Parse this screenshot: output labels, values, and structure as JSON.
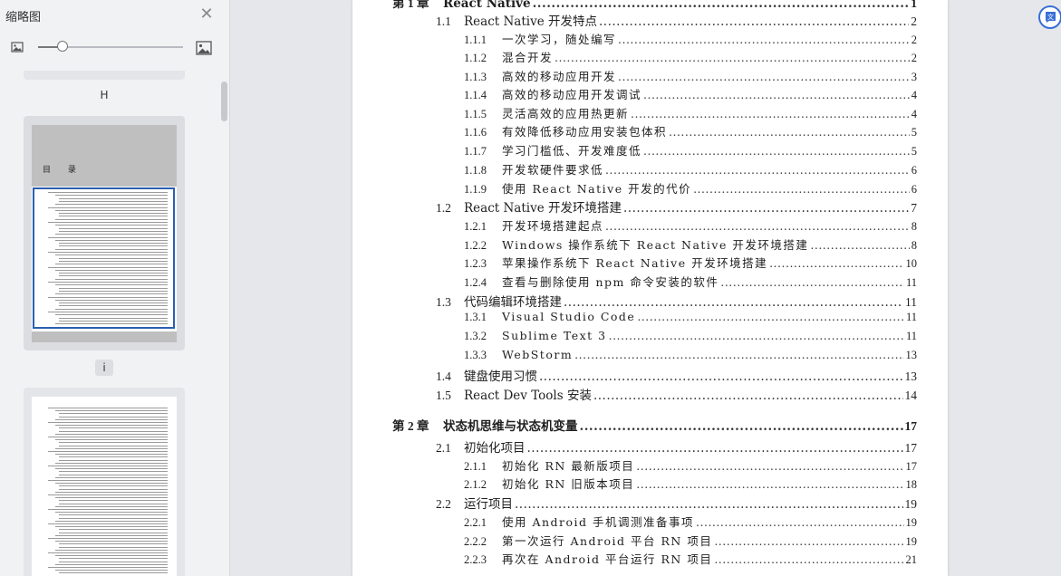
{
  "sidebar": {
    "title": "缩略图",
    "zoom_level": 0.17,
    "thumbnails": [
      {
        "label": "H",
        "heading": "目 录",
        "selected": true
      },
      {
        "label": "i",
        "selected": false
      }
    ]
  },
  "toc": [
    {
      "level": 0,
      "num": "第 1 章",
      "title": "React Native",
      "page": "1"
    },
    {
      "level": 1,
      "num": "1.1",
      "title": "React Native 开发特点",
      "page": "2"
    },
    {
      "level": 2,
      "num": "1.1.1",
      "title": "一次学习，随处编写",
      "page": "2"
    },
    {
      "level": 2,
      "num": "1.1.2",
      "title": "混合开发",
      "page": "2"
    },
    {
      "level": 2,
      "num": "1.1.3",
      "title": "高效的移动应用开发",
      "page": "3"
    },
    {
      "level": 2,
      "num": "1.1.4",
      "title": "高效的移动应用开发调试",
      "page": "4"
    },
    {
      "level": 2,
      "num": "1.1.5",
      "title": "灵活高效的应用热更新",
      "page": "4"
    },
    {
      "level": 2,
      "num": "1.1.6",
      "title": "有效降低移动应用安装包体积",
      "page": "5"
    },
    {
      "level": 2,
      "num": "1.1.7",
      "title": "学习门槛低、开发难度低",
      "page": "5"
    },
    {
      "level": 2,
      "num": "1.1.8",
      "title": "开发软硬件要求低",
      "page": "6"
    },
    {
      "level": 2,
      "num": "1.1.9",
      "title": "使用 React Native 开发的代价",
      "page": "6"
    },
    {
      "level": 1,
      "num": "1.2",
      "title": "React Native 开发环境搭建",
      "page": "7"
    },
    {
      "level": 2,
      "num": "1.2.1",
      "title": "开发环境搭建起点",
      "page": "8"
    },
    {
      "level": 2,
      "num": "1.2.2",
      "title": "Windows 操作系统下 React Native 开发环境搭建",
      "page": "8"
    },
    {
      "level": 2,
      "num": "1.2.3",
      "title": "苹果操作系统下 React Native 开发环境搭建",
      "page": "10"
    },
    {
      "level": 2,
      "num": "1.2.4",
      "title": "查看与删除使用 npm 命令安装的软件",
      "page": "11"
    },
    {
      "level": 1,
      "num": "1.3",
      "title": "代码编辑环境搭建",
      "page": "11"
    },
    {
      "level": 2,
      "num": "1.3.1",
      "title": "Visual Studio Code",
      "page": "11"
    },
    {
      "level": 2,
      "num": "1.3.2",
      "title": "Sublime Text 3",
      "page": "11"
    },
    {
      "level": 2,
      "num": "1.3.3",
      "title": "WebStorm",
      "page": "13"
    },
    {
      "level": 1,
      "num": "1.4",
      "title": "键盘使用习惯",
      "page": "13"
    },
    {
      "level": 1,
      "num": "1.5",
      "title": "React Dev Tools 安装",
      "page": "14"
    },
    {
      "level": 0,
      "num": "第 2 章",
      "title": "状态机思维与状态机变量",
      "page": "17"
    },
    {
      "level": 1,
      "num": "2.1",
      "title": "初始化项目",
      "page": "17"
    },
    {
      "level": 2,
      "num": "2.1.1",
      "title": "初始化 RN 最新版项目",
      "page": "17"
    },
    {
      "level": 2,
      "num": "2.1.2",
      "title": "初始化 RN 旧版本项目",
      "page": "18"
    },
    {
      "level": 1,
      "num": "2.2",
      "title": "运行项目",
      "page": "19"
    },
    {
      "level": 2,
      "num": "2.2.1",
      "title": "使用 Android 手机调测准备事项",
      "page": "19"
    },
    {
      "level": 2,
      "num": "2.2.2",
      "title": "第一次运行 Android 平台 RN 项目",
      "page": "19"
    },
    {
      "level": 2,
      "num": "2.2.3",
      "title": "再次在 Android 平台运行 RN 项目",
      "page": "21"
    }
  ]
}
